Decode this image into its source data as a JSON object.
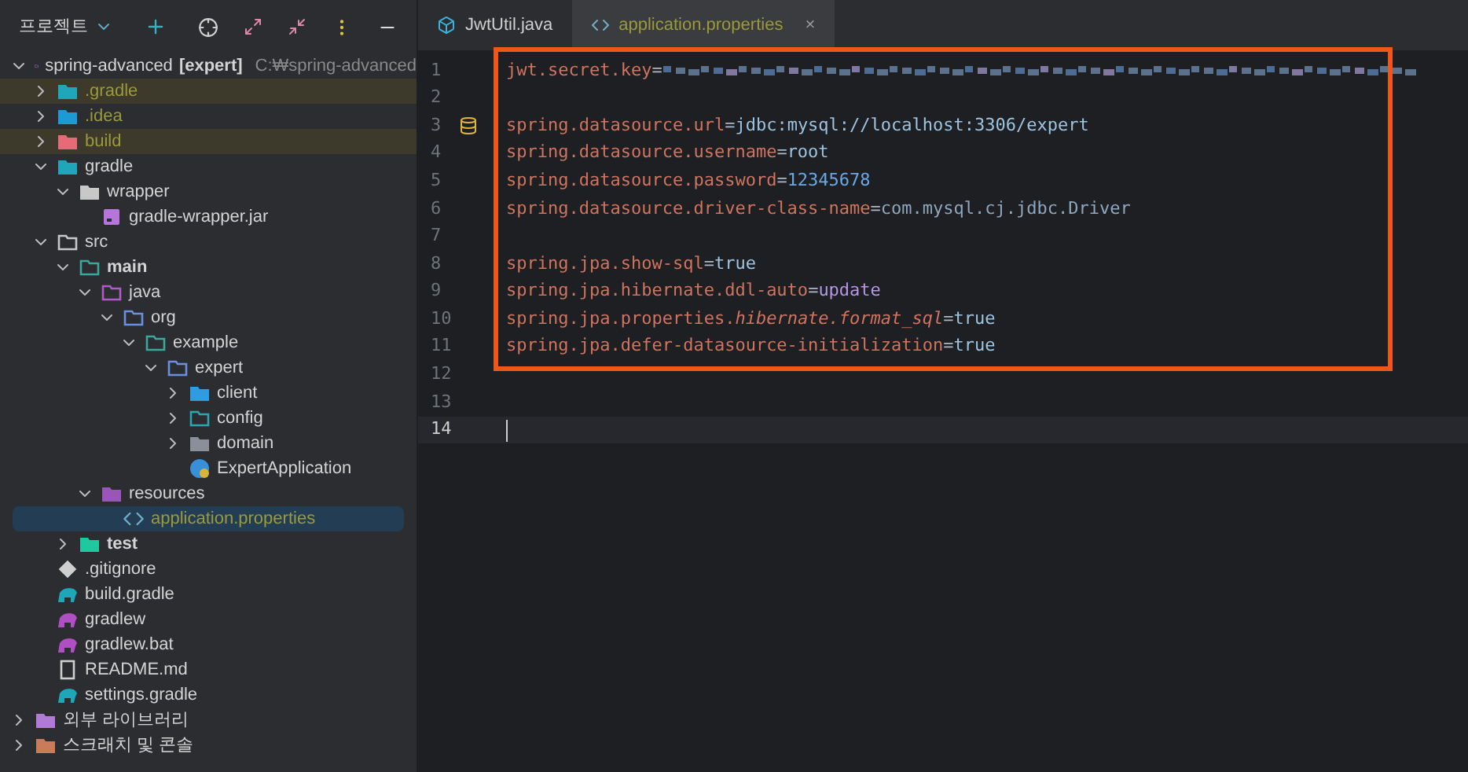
{
  "sidebar": {
    "title": "프로젝트",
    "tree": [
      {
        "label": "spring-advanced",
        "tag": "[expert]",
        "hint": "C:₩spring-advanced",
        "kind": "module",
        "expanded": true,
        "selected": false,
        "bold": false,
        "children": [
          {
            "label": ".gradle",
            "kind": "gradle-folder",
            "expanded": false,
            "excluded": true,
            "selected": false,
            "bold": false
          },
          {
            "label": ".idea",
            "kind": "idea-folder",
            "expanded": false,
            "untracked": true,
            "selected": false,
            "bold": false
          },
          {
            "label": "build",
            "kind": "build-folder",
            "expanded": false,
            "excluded": true,
            "selected": false,
            "bold": false
          },
          {
            "label": "gradle",
            "kind": "gradle-folder",
            "expanded": true,
            "selected": false,
            "bold": false,
            "children": [
              {
                "label": "wrapper",
                "kind": "plain-folder",
                "expanded": true,
                "selected": false,
                "bold": false,
                "children": [
                  {
                    "label": "gradle-wrapper.jar",
                    "kind": "jar",
                    "selected": false,
                    "bold": false
                  }
                ]
              }
            ]
          },
          {
            "label": "src",
            "kind": "outline-folder",
            "expanded": true,
            "selected": false,
            "bold": false,
            "children": [
              {
                "label": "main",
                "kind": "source-root",
                "expanded": true,
                "selected": false,
                "bold": true,
                "children": [
                  {
                    "label": "java",
                    "kind": "java-root",
                    "expanded": true,
                    "selected": false,
                    "bold": false,
                    "children": [
                      {
                        "label": "org",
                        "kind": "package",
                        "expanded": true,
                        "selected": false,
                        "bold": false,
                        "children": [
                          {
                            "label": "example",
                            "kind": "source-root",
                            "expanded": true,
                            "selected": false,
                            "bold": false,
                            "children": [
                              {
                                "label": "expert",
                                "kind": "package",
                                "expanded": true,
                                "selected": false,
                                "bold": false,
                                "children": [
                                  {
                                    "label": "client",
                                    "kind": "blue-folder",
                                    "expanded": false,
                                    "selected": false,
                                    "bold": false
                                  },
                                  {
                                    "label": "config",
                                    "kind": "teal-folder",
                                    "expanded": false,
                                    "selected": false,
                                    "bold": false
                                  },
                                  {
                                    "label": "domain",
                                    "kind": "gray-folder",
                                    "expanded": false,
                                    "selected": false,
                                    "bold": false
                                  },
                                  {
                                    "label": "ExpertApplication",
                                    "kind": "spring-class",
                                    "selected": false,
                                    "bold": false
                                  }
                                ]
                              }
                            ]
                          }
                        ]
                      }
                    ]
                  },
                  {
                    "label": "resources",
                    "kind": "resources-root",
                    "expanded": true,
                    "selected": false,
                    "bold": false,
                    "children": [
                      {
                        "label": "application.properties",
                        "kind": "properties",
                        "untracked": true,
                        "selected": true,
                        "bold": false
                      }
                    ]
                  }
                ]
              },
              {
                "label": "test",
                "kind": "test-folder",
                "expanded": false,
                "selected": false,
                "bold": true
              }
            ]
          },
          {
            "label": ".gitignore",
            "kind": "git",
            "selected": false,
            "bold": false
          },
          {
            "label": "build.gradle",
            "kind": "gradle-file",
            "selected": false,
            "bold": false
          },
          {
            "label": "gradlew",
            "kind": "gradlew",
            "selected": false,
            "bold": false
          },
          {
            "label": "gradlew.bat",
            "kind": "gradlew",
            "selected": false,
            "bold": false
          },
          {
            "label": "README.md",
            "kind": "readme",
            "selected": false,
            "bold": false
          },
          {
            "label": "settings.gradle",
            "kind": "gradle-file",
            "selected": false,
            "bold": false
          }
        ]
      },
      {
        "label": "외부 라이브러리",
        "kind": "library",
        "expanded": false,
        "selected": false,
        "bold": false
      },
      {
        "label": "스크래치 및 콘솔",
        "kind": "scratch",
        "expanded": false,
        "selected": false,
        "bold": false
      }
    ]
  },
  "tabs": [
    {
      "label": "JwtUtil.java",
      "kind": "java",
      "selected": false
    },
    {
      "label": "application.properties",
      "kind": "properties",
      "untracked": true,
      "selected": true,
      "close": "×"
    }
  ],
  "editor": {
    "lines": [
      {
        "number": "1",
        "segments": [
          {
            "kind": "key",
            "text": "jwt.secret.key"
          },
          {
            "kind": "eq",
            "text": "="
          },
          {
            "kind": "redacted"
          }
        ]
      },
      {
        "number": "2"
      },
      {
        "number": "3",
        "gutter_icon": true,
        "segments": [
          {
            "kind": "key",
            "text": "spring.datasource.url"
          },
          {
            "kind": "eq",
            "text": "="
          },
          {
            "kind": "value",
            "text": "jdbc:mysql://localhost:3306/expert"
          }
        ]
      },
      {
        "number": "4",
        "segments": [
          {
            "kind": "key",
            "text": "spring.datasource.username"
          },
          {
            "kind": "eq",
            "text": "="
          },
          {
            "kind": "value",
            "text": "root"
          }
        ]
      },
      {
        "number": "5",
        "segments": [
          {
            "kind": "key",
            "text": "spring.datasource.password"
          },
          {
            "kind": "eq",
            "text": "="
          },
          {
            "kind": "number",
            "text": "12345678"
          }
        ]
      },
      {
        "number": "6",
        "segments": [
          {
            "kind": "key",
            "text": "spring.datasource.driver-class-name"
          },
          {
            "kind": "eq",
            "text": "="
          },
          {
            "kind": "class",
            "text": "com.mysql.cj.jdbc.Driver"
          }
        ]
      },
      {
        "number": "7"
      },
      {
        "number": "8",
        "segments": [
          {
            "kind": "key",
            "text": "spring.jpa.show-sql"
          },
          {
            "kind": "eq",
            "text": "="
          },
          {
            "kind": "value",
            "text": "true"
          }
        ]
      },
      {
        "number": "9",
        "segments": [
          {
            "kind": "key",
            "text": "spring.jpa.hibernate.ddl-auto"
          },
          {
            "kind": "eq",
            "text": "="
          },
          {
            "kind": "enum",
            "text": "update"
          }
        ]
      },
      {
        "number": "10",
        "segments": [
          {
            "kind": "key",
            "text": "spring.jpa.properties."
          },
          {
            "kind": "italic_key",
            "text": "hibernate.format_sql"
          },
          {
            "kind": "eq",
            "text": "="
          },
          {
            "kind": "value",
            "text": "true"
          }
        ]
      },
      {
        "number": "11",
        "segments": [
          {
            "kind": "key",
            "text": "spring.jpa.defer-datasource-initialization"
          },
          {
            "kind": "eq",
            "text": "="
          },
          {
            "kind": "value",
            "text": "true"
          }
        ]
      },
      {
        "number": "12"
      },
      {
        "number": "13"
      },
      {
        "number": "14",
        "current": true
      }
    ]
  }
}
